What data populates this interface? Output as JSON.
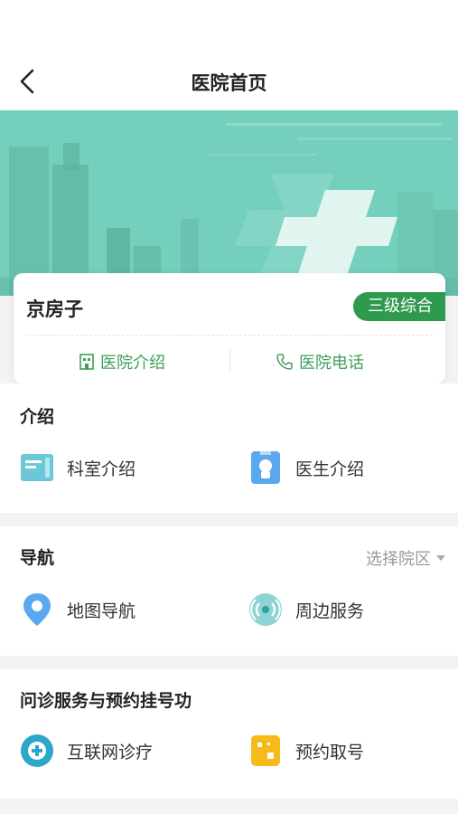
{
  "nav": {
    "title": "医院首页",
    "back_icon": "chevron-left-icon"
  },
  "hospital": {
    "name": "京房子",
    "level": "三级综合"
  },
  "card_actions": [
    {
      "label": "医院介绍",
      "icon": "building-icon"
    },
    {
      "label": "医院电话",
      "icon": "phone-icon"
    }
  ],
  "sections": {
    "intro": {
      "title": "介绍",
      "items": [
        {
          "label": "科室介绍",
          "icon": "department-icon"
        },
        {
          "label": "医生介绍",
          "icon": "doctor-icon"
        }
      ]
    },
    "navigation": {
      "title": "导航",
      "select_campus": "选择院区",
      "items": [
        {
          "label": "地图导航",
          "icon": "map-pin-icon"
        },
        {
          "label": "周边服务",
          "icon": "radar-icon"
        }
      ]
    },
    "services": {
      "title": "问诊服务与预约挂号功",
      "items": [
        {
          "label": "互联网诊疗",
          "icon": "telemedicine-icon"
        },
        {
          "label": "预约取号",
          "icon": "ticket-icon"
        }
      ]
    }
  },
  "colors": {
    "accent": "#2f9a4d",
    "banner": "#6fcab6",
    "text": "#222222"
  }
}
